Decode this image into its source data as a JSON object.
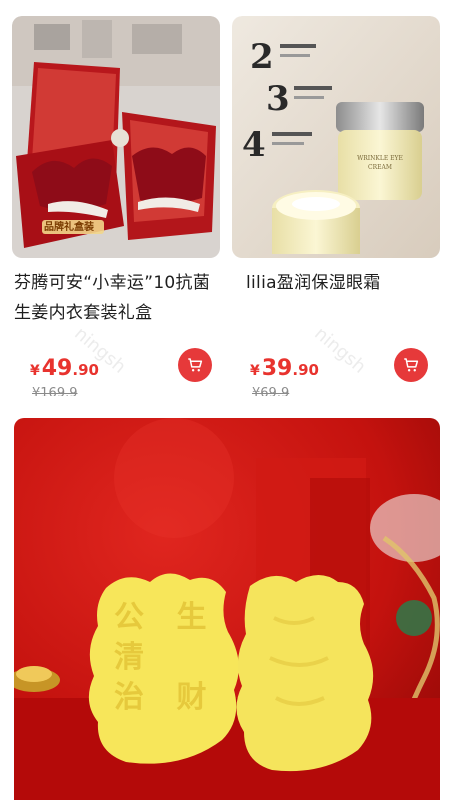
{
  "products": [
    {
      "title": "芬腾可安“小幸运”10抗菌生姜内衣套装礼盒",
      "price_symbol": "¥",
      "price_int": "49",
      "price_dec": ".90",
      "original_price": "¥169.9",
      "image_caption": "品牌礼盒装",
      "cart_icon": "cart-icon"
    },
    {
      "title": "lilia盈润保湿眼霜",
      "price_symbol": "¥",
      "price_int": "39",
      "price_dec": ".90",
      "original_price": "¥69.9",
      "image_texts": [
        "2",
        "3",
        "4"
      ],
      "jar_label": "WRINKLE EYE CREAM",
      "cart_icon": "cart-icon"
    }
  ],
  "bottom_banner": {
    "sticker_text": [
      "公",
      "清",
      "治",
      "生",
      "财"
    ]
  },
  "watermark": "ningsh"
}
